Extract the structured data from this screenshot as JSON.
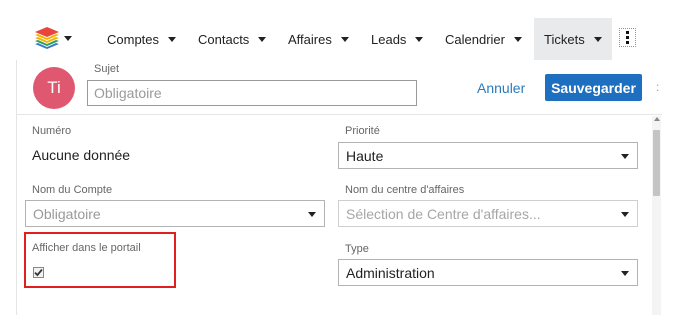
{
  "nav": {
    "items": [
      {
        "label": "Comptes"
      },
      {
        "label": "Contacts"
      },
      {
        "label": "Affaires"
      },
      {
        "label": "Leads"
      },
      {
        "label": "Calendrier"
      },
      {
        "label": "Tickets",
        "active": true
      }
    ],
    "more_icon": "vertical-dots-icon",
    "logo_icon": "layers-stack-icon"
  },
  "header": {
    "avatar_initials": "Ti",
    "subject_label": "Sujet",
    "subject_placeholder": "Obligatoire",
    "subject_value": "",
    "cancel_label": "Annuler",
    "save_label": "Sauvegarder",
    "edge_glyph": ":"
  },
  "form": {
    "numero": {
      "label": "Numéro",
      "value": "Aucune donnée"
    },
    "priorite": {
      "label": "Priorité",
      "value": "Haute"
    },
    "compte": {
      "label": "Nom du Compte",
      "placeholder": "Obligatoire"
    },
    "centre": {
      "label": "Nom du centre d'affaires",
      "placeholder": "Sélection de Centre d'affaires..."
    },
    "portail": {
      "label": "Afficher dans le portail",
      "checked": true
    },
    "type": {
      "label": "Type",
      "value": "Administration"
    }
  },
  "colors": {
    "accent": "#1e6fbf",
    "link": "#2b7bbd",
    "avatar": "#e05770",
    "highlight": "#e02020",
    "active_tab": "#e8eaec"
  }
}
